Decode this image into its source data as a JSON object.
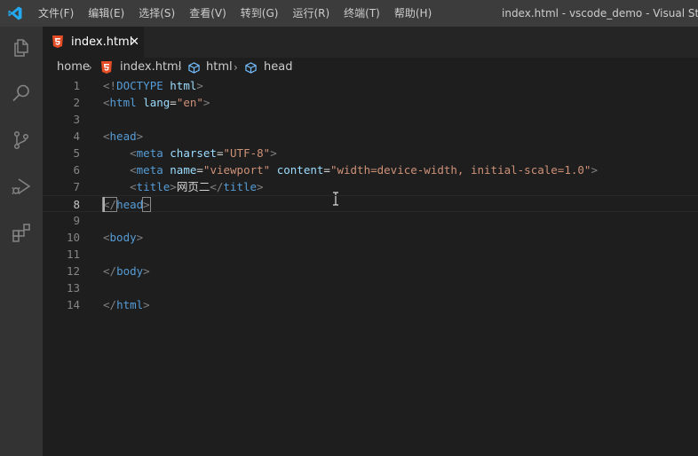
{
  "titlebar": {
    "menu": [
      "文件(F)",
      "编辑(E)",
      "选择(S)",
      "查看(V)",
      "转到(G)",
      "运行(R)",
      "终端(T)",
      "帮助(H)"
    ],
    "title": "index.html - vscode_demo - Visual Studio"
  },
  "activitybar": {
    "icons": [
      "explorer-icon",
      "search-icon",
      "source-control-icon",
      "run-debug-icon",
      "extensions-icon"
    ]
  },
  "tab": {
    "label": "index.html",
    "close": "✕",
    "icon": "html5-icon"
  },
  "breadcrumb": {
    "items": [
      "home",
      "index.html",
      "html",
      "head"
    ]
  },
  "editor": {
    "line_numbers": [
      "1",
      "2",
      "3",
      "4",
      "5",
      "6",
      "7",
      "8",
      "9",
      "10",
      "11",
      "12",
      "13",
      "14"
    ],
    "lines": [
      [
        {
          "t": "<!",
          "c": "bracket"
        },
        {
          "t": "DOCTYPE",
          "c": "tag"
        },
        {
          "t": " html",
          "c": "attr"
        },
        {
          "t": ">",
          "c": "bracket"
        }
      ],
      [
        {
          "t": "<",
          "c": "bracket"
        },
        {
          "t": "html",
          "c": "tag"
        },
        {
          "t": " lang",
          "c": "attr"
        },
        {
          "t": "=",
          "c": "eq"
        },
        {
          "t": "\"en\"",
          "c": "str"
        },
        {
          "t": ">",
          "c": "bracket"
        }
      ],
      [],
      [
        {
          "t": "<",
          "c": "bracket"
        },
        {
          "t": "head",
          "c": "tag"
        },
        {
          "t": ">",
          "c": "bracket"
        }
      ],
      [
        {
          "t": "    <",
          "c": "bracket"
        },
        {
          "t": "meta",
          "c": "tag"
        },
        {
          "t": " charset",
          "c": "attr"
        },
        {
          "t": "=",
          "c": "eq"
        },
        {
          "t": "\"UTF-8\"",
          "c": "str"
        },
        {
          "t": ">",
          "c": "bracket"
        }
      ],
      [
        {
          "t": "    <",
          "c": "bracket"
        },
        {
          "t": "meta",
          "c": "tag"
        },
        {
          "t": " name",
          "c": "attr"
        },
        {
          "t": "=",
          "c": "eq"
        },
        {
          "t": "\"viewport\"",
          "c": "str"
        },
        {
          "t": " content",
          "c": "attr"
        },
        {
          "t": "=",
          "c": "eq"
        },
        {
          "t": "\"width=device-width, initial-scale=1.0\"",
          "c": "str"
        },
        {
          "t": ">",
          "c": "bracket"
        }
      ],
      [
        {
          "t": "    <",
          "c": "bracket"
        },
        {
          "t": "title",
          "c": "tag"
        },
        {
          "t": ">",
          "c": "bracket"
        },
        {
          "t": "网页二",
          "c": "text"
        },
        {
          "t": "</",
          "c": "bracket"
        },
        {
          "t": "title",
          "c": "tag"
        },
        {
          "t": ">",
          "c": "bracket"
        }
      ],
      [
        {
          "t": "</",
          "c": "bracket"
        },
        {
          "t": "head",
          "c": "tag"
        },
        {
          "t": ">",
          "c": "bracket"
        }
      ],
      [],
      [
        {
          "t": "<",
          "c": "bracket"
        },
        {
          "t": "body",
          "c": "tag"
        },
        {
          "t": ">",
          "c": "bracket"
        }
      ],
      [],
      [
        {
          "t": "</",
          "c": "bracket"
        },
        {
          "t": "body",
          "c": "tag"
        },
        {
          "t": ">",
          "c": "bracket"
        }
      ],
      [],
      [
        {
          "t": "</",
          "c": "bracket"
        },
        {
          "t": "html",
          "c": "tag"
        },
        {
          "t": ">",
          "c": "bracket"
        }
      ]
    ],
    "current_line": 8
  },
  "colors": {
    "accent": "#007acc",
    "html5_icon": "#e44d26",
    "tag": "#569cd6",
    "attribute": "#9cdcfe",
    "string": "#ce9178"
  }
}
